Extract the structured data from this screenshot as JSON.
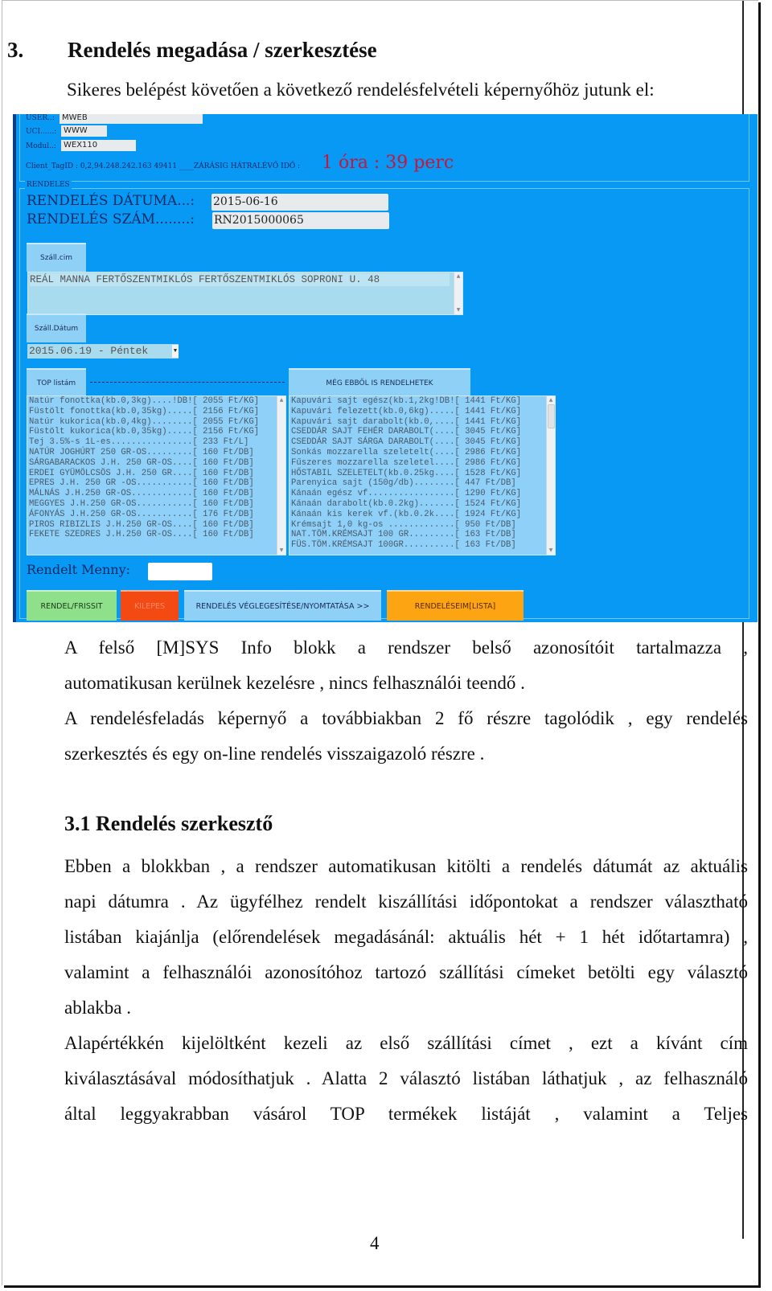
{
  "document": {
    "heading": {
      "number": "3.",
      "title": "Rendelés megadása / szerkesztése"
    },
    "intro": "Sikeres belépést követően a következő rendelésfelvételi képernyőhöz jutunk el:",
    "paragraphs": [
      "A felső [M]SYS Info  blokk a rendszer belső azonosítóit tartalmazza ,",
      "automatikusan kerülnek kezelésre , nincs felhasználói teendő .",
      "A rendelésfeladás képernyő a továbbiakban 2 fő részre tagolódik , egy rendelés",
      "szerkesztés és egy on-line rendelés visszaigazoló részre ."
    ],
    "subheading": "3.1  Rendelés szerkesztő",
    "sub_paragraphs": [
      "Ebben a blokkban , a rendszer automatikusan kitölti a rendelés dátumát az aktuális",
      "napi dátumra . Az ügyfélhez rendelt kiszállítási időpontokat a rendszer választható",
      "listában kiajánlja (előrendelések megadásánál: aktuális hét + 1 hét időtartamra) ,",
      "valamint a felhasználói azonosítóhoz tartozó szállítási címeket betölti egy választó",
      "ablakba .",
      "Alapértékkén kijelöltként kezeli az első szállítási címet , ezt a kívánt cím",
      "kiválasztásával módosíthatjuk . Alatta 2 választó listában láthatjuk , az felhasználó",
      "által leggyakrabban vásárol TOP termékek listáját , valamint a Teljes"
    ],
    "page_number": "4"
  },
  "app": {
    "sys": {
      "user_label": "USER..:",
      "user_value": "MWEB",
      "uci_label": "UCI......:",
      "uci_value": "WWW",
      "modul_label": "Modul..:",
      "modul_value": "WEX110",
      "client_tag": "Client_TagID : 0,2,94.248.242.163 49411 ____ZÁRÁSIG HÁTRALÉVŐ IDŐ :",
      "timer": "1 óra : 39 perc"
    },
    "rendeles_legend": "RENDELES",
    "datum_label": "RENDELÉS DÁTUMA...:",
    "datum_value": "2015-06-16",
    "szam_label": "RENDELÉS SZÁM........:",
    "szam_value": "RN2015000065",
    "szallcim_button": "Száll.cim",
    "address": "REÁL MANNA FERTŐSZENTMIKLÓS FERTŐSZENTMIKLÓS SOPRONI U. 48",
    "szalldatum_button": "Száll.Dátum",
    "delivery_date": "2015.06.19 - Péntek",
    "top_button": "TOP listám",
    "more_button": "MÉG EBBŐL IS RENDELHETEK",
    "top_list": [
      "Natúr fonottka(kb.0,3kg)....!DB![ 2055 Ft/KG]",
      "Füstölt fonottka(kb.0,35kg).....[ 2156 Ft/KG]",
      "Natúr kukorica(kb.0,4kg)........[ 2055 Ft/KG]",
      "Füstölt kukorica(kb.0,35kg).....[ 2156 Ft/KG]",
      "Tej 3.5%-s 1L-es................[ 233 Ft/L]",
      "NATÚR JOGHÚRT 250 GR-OS.........[ 160 Ft/DB]",
      "SÁRGABARACKOS J.H. 250 GR-OS....[ 160 Ft/DB]",
      "ERDEI GYÜMÖLCSÖS J.H. 250 GR....[ 160 Ft/DB]",
      "EPRES J.H. 250 GR -OS...........[ 160 Ft/DB]",
      "MÁLNÁS J.H.250 GR-OS............[ 160 Ft/DB]",
      "MEGGYES J.H.250 GR-OS...........[ 160 Ft/DB]",
      "ÁFONYÁS J.H.250 GR-OS...........[ 176 Ft/DB]",
      "PIROS RIBIZLIS J.H.250 GR-OS....[ 160 Ft/DB]",
      "FEKETE SZEDRES J.H.250 GR-OS....[ 160 Ft/DB]"
    ],
    "more_list": [
      "Kapuvári sajt egész(kb.1,2kg!DB![ 1441 Ft/KG]",
      "Kapuvári felezett(kb.0,6kg).....[ 1441 Ft/KG]",
      "Kapuvári sajt darabolt(kb.0,....[ 1441 Ft/KG]",
      "CSEDDÁR SAJT FEHÉR DARABOLT(....[ 3045 Ft/KG]",
      "CSEDDÁR SAJT SÁRGA DARABOLT(....[ 3045 Ft/KG]",
      "Sonkás mozzarella szeletelt(....[ 2986 Ft/KG]",
      "Fűszeres mozzarella szeletel....[ 2986 Ft/KG]",
      "HŐSTABIL SZELETELT(kb.0.25kg....[ 1528 Ft/KG]",
      "Parenyica sajt (150g/db)........[ 447 Ft/DB]",
      "Kánaán egész vf.................[ 1290 Ft/KG]",
      "Kánaán darabolt(kb.0.2kg).......[ 1524 Ft/KG]",
      "Kánaán kis kerek vf.(kb.0.2k....[ 1924 Ft/KG]",
      "Krémsajt 1,0 kg-os .............[ 950 Ft/DB]",
      "NAT.TÖM.KRÉMSAJT 100 GR.........[ 163 Ft/DB]",
      "FÜS.TÖM.KRÉMSAJT 100GR..........[ 163 Ft/DB]"
    ],
    "menny_label": "Rendelt Menny:",
    "menny_value": "",
    "buttons": {
      "rendel": "RENDEL/FRISSIT",
      "kilepes": "KILEPES",
      "veglegesites": "RENDELÉS VÉGLEGESÍTÉSE/NYOMTATÁSA >>",
      "lista": "RENDELÉSEIM[LISTA]"
    },
    "colors": {
      "background": "#0899f4",
      "timer": "#c8153a",
      "rendel_btn": "#8fe08a",
      "kilepes_btn": "#f24a12",
      "veglegesites_btn": "#8fd0f7",
      "lista_btn": "#fca411"
    }
  }
}
